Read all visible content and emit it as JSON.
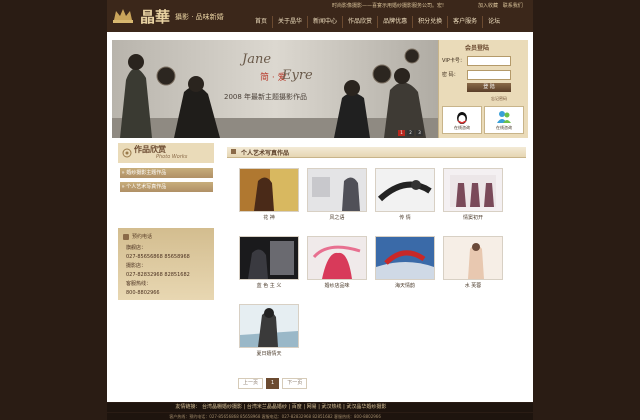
{
  "header": {
    "brand_cn": "晶華",
    "brand_sub": "攝影 · 品味新婚",
    "topline": "时尚影像摄影——喜宴示用婚纱摄影服务公司。宏!",
    "toplinks": [
      "加入收藏",
      "联系我们"
    ],
    "nav": [
      "首页",
      "关于晶华",
      "新闻中心",
      "作品欣赏",
      "品牌优惠",
      "积分兑换",
      "客户服务",
      "论坛"
    ]
  },
  "banner": {
    "title_en_1": "Jane",
    "title_cn": "简 · 爱",
    "title_en_2": "Eyre",
    "caption": "2008 年最新主题摄影作品",
    "dots": [
      "1",
      "2",
      "3"
    ]
  },
  "login": {
    "title": "会员登陆",
    "vip_label": "VIP卡号：",
    "pwd_label": "密    码：",
    "submit": "登 陆",
    "forgot": "忘记密码",
    "service_1": "在线咨询",
    "service_2": "在线咨询"
  },
  "sidebar": {
    "title_cn": "作品欣赏",
    "title_en": "Photo Works",
    "items": [
      "婚纱摄影主题作品",
      "个人艺术写真作品"
    ],
    "contact_title": "预约电话",
    "contact_lines": [
      "旗舰店：",
      "027-85656868  85658968",
      "摄影店：",
      "027-82832968  82851682",
      "客服热线：",
      "800-8802966"
    ]
  },
  "section": {
    "title": "个人艺术写真作品"
  },
  "gallery": [
    {
      "caption": "花 神"
    },
    {
      "caption": "风之语"
    },
    {
      "caption": "传 情"
    },
    {
      "caption": "情窦初开"
    },
    {
      "caption": "蓝 色 主 义"
    },
    {
      "caption": "婚纱店品味"
    },
    {
      "caption": "海天情韵"
    },
    {
      "caption": "水 芙蓉"
    },
    {
      "caption": "夏日嬉情天"
    }
  ],
  "pager": {
    "prev": "上一页",
    "current": "1",
    "next": "下一页"
  },
  "footer": {
    "links_label": "友情链接：",
    "links": [
      "台湾晶棚婚纱摄影",
      "台湾米兰晶晶婚纱",
      "百度",
      "网易",
      "武汉热线",
      "武汉晶华婚纱摄影"
    ],
    "line2": "客户热线：预约电话：027-85656868 85658968  客服电话：027-82832968 82851682  客服热线：800-8802966"
  },
  "colors": {
    "bg": "#2a1c14",
    "header": "#3b271a",
    "accent": "#b09066"
  }
}
